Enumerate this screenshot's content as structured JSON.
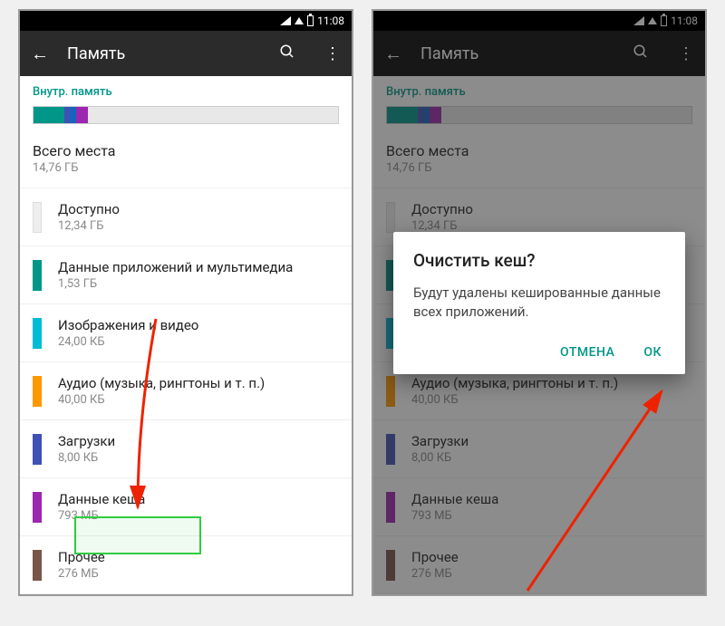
{
  "statusbar": {
    "time": "11:08"
  },
  "appbar": {
    "title": "Память"
  },
  "section_header": "Внутр. память",
  "total": {
    "label": "Всего места",
    "value": "14,76 ГБ"
  },
  "storage_segments": [
    {
      "color": "#009688",
      "pct": 10
    },
    {
      "color": "#3f51b5",
      "pct": 2
    },
    {
      "color": "#1565c0",
      "pct": 2
    },
    {
      "color": "#9c27b0",
      "pct": 4
    },
    {
      "color": "#e8e8e8",
      "pct": 82
    }
  ],
  "items": [
    {
      "title": "Доступно",
      "sub": "12,34 ГБ",
      "color": ""
    },
    {
      "title": "Данные приложений и мультимедиа",
      "sub": "1,53 ГБ",
      "color": "#009688"
    },
    {
      "title": "Изображения и видео",
      "sub": "24,00 КБ",
      "color": "#00bcd4"
    },
    {
      "title": "Аудио (музыка, рингтоны и т. п.)",
      "sub": "40,00 КБ",
      "color": "#ff9800"
    },
    {
      "title": "Загрузки",
      "sub": "8,00 КБ",
      "color": "#3f51b5"
    },
    {
      "title": "Данные кеша",
      "sub": "793 МБ",
      "color": "#9c27b0"
    },
    {
      "title": "Прочее",
      "sub": "276 МБ",
      "color": "#795548"
    }
  ],
  "dialog": {
    "title": "Очистить кеш?",
    "body": "Будут удалены кешированные данные всех приложений.",
    "cancel": "ОТМЕНА",
    "ok": "ОК"
  }
}
